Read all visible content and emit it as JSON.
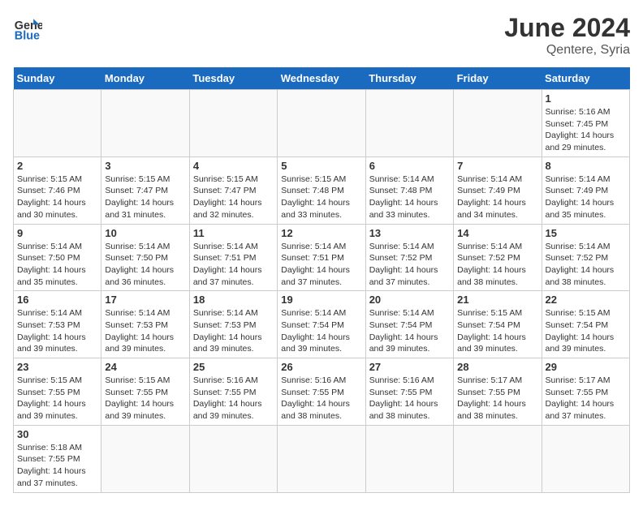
{
  "header": {
    "logo_general": "General",
    "logo_blue": "Blue",
    "month_title": "June 2024",
    "location": "Qentere, Syria"
  },
  "weekdays": [
    "Sunday",
    "Monday",
    "Tuesday",
    "Wednesday",
    "Thursday",
    "Friday",
    "Saturday"
  ],
  "weeks": [
    [
      {
        "day": "",
        "info": ""
      },
      {
        "day": "",
        "info": ""
      },
      {
        "day": "",
        "info": ""
      },
      {
        "day": "",
        "info": ""
      },
      {
        "day": "",
        "info": ""
      },
      {
        "day": "",
        "info": ""
      },
      {
        "day": "1",
        "info": "Sunrise: 5:16 AM\nSunset: 7:45 PM\nDaylight: 14 hours and 29 minutes."
      }
    ],
    [
      {
        "day": "2",
        "info": "Sunrise: 5:15 AM\nSunset: 7:46 PM\nDaylight: 14 hours and 30 minutes."
      },
      {
        "day": "3",
        "info": "Sunrise: 5:15 AM\nSunset: 7:47 PM\nDaylight: 14 hours and 31 minutes."
      },
      {
        "day": "4",
        "info": "Sunrise: 5:15 AM\nSunset: 7:47 PM\nDaylight: 14 hours and 32 minutes."
      },
      {
        "day": "5",
        "info": "Sunrise: 5:15 AM\nSunset: 7:48 PM\nDaylight: 14 hours and 33 minutes."
      },
      {
        "day": "6",
        "info": "Sunrise: 5:14 AM\nSunset: 7:48 PM\nDaylight: 14 hours and 33 minutes."
      },
      {
        "day": "7",
        "info": "Sunrise: 5:14 AM\nSunset: 7:49 PM\nDaylight: 14 hours and 34 minutes."
      },
      {
        "day": "8",
        "info": "Sunrise: 5:14 AM\nSunset: 7:49 PM\nDaylight: 14 hours and 35 minutes."
      }
    ],
    [
      {
        "day": "9",
        "info": "Sunrise: 5:14 AM\nSunset: 7:50 PM\nDaylight: 14 hours and 35 minutes."
      },
      {
        "day": "10",
        "info": "Sunrise: 5:14 AM\nSunset: 7:50 PM\nDaylight: 14 hours and 36 minutes."
      },
      {
        "day": "11",
        "info": "Sunrise: 5:14 AM\nSunset: 7:51 PM\nDaylight: 14 hours and 37 minutes."
      },
      {
        "day": "12",
        "info": "Sunrise: 5:14 AM\nSunset: 7:51 PM\nDaylight: 14 hours and 37 minutes."
      },
      {
        "day": "13",
        "info": "Sunrise: 5:14 AM\nSunset: 7:52 PM\nDaylight: 14 hours and 37 minutes."
      },
      {
        "day": "14",
        "info": "Sunrise: 5:14 AM\nSunset: 7:52 PM\nDaylight: 14 hours and 38 minutes."
      },
      {
        "day": "15",
        "info": "Sunrise: 5:14 AM\nSunset: 7:52 PM\nDaylight: 14 hours and 38 minutes."
      }
    ],
    [
      {
        "day": "16",
        "info": "Sunrise: 5:14 AM\nSunset: 7:53 PM\nDaylight: 14 hours and 39 minutes."
      },
      {
        "day": "17",
        "info": "Sunrise: 5:14 AM\nSunset: 7:53 PM\nDaylight: 14 hours and 39 minutes."
      },
      {
        "day": "18",
        "info": "Sunrise: 5:14 AM\nSunset: 7:53 PM\nDaylight: 14 hours and 39 minutes."
      },
      {
        "day": "19",
        "info": "Sunrise: 5:14 AM\nSunset: 7:54 PM\nDaylight: 14 hours and 39 minutes."
      },
      {
        "day": "20",
        "info": "Sunrise: 5:14 AM\nSunset: 7:54 PM\nDaylight: 14 hours and 39 minutes."
      },
      {
        "day": "21",
        "info": "Sunrise: 5:15 AM\nSunset: 7:54 PM\nDaylight: 14 hours and 39 minutes."
      },
      {
        "day": "22",
        "info": "Sunrise: 5:15 AM\nSunset: 7:54 PM\nDaylight: 14 hours and 39 minutes."
      }
    ],
    [
      {
        "day": "23",
        "info": "Sunrise: 5:15 AM\nSunset: 7:55 PM\nDaylight: 14 hours and 39 minutes."
      },
      {
        "day": "24",
        "info": "Sunrise: 5:15 AM\nSunset: 7:55 PM\nDaylight: 14 hours and 39 minutes."
      },
      {
        "day": "25",
        "info": "Sunrise: 5:16 AM\nSunset: 7:55 PM\nDaylight: 14 hours and 39 minutes."
      },
      {
        "day": "26",
        "info": "Sunrise: 5:16 AM\nSunset: 7:55 PM\nDaylight: 14 hours and 38 minutes."
      },
      {
        "day": "27",
        "info": "Sunrise: 5:16 AM\nSunset: 7:55 PM\nDaylight: 14 hours and 38 minutes."
      },
      {
        "day": "28",
        "info": "Sunrise: 5:17 AM\nSunset: 7:55 PM\nDaylight: 14 hours and 38 minutes."
      },
      {
        "day": "29",
        "info": "Sunrise: 5:17 AM\nSunset: 7:55 PM\nDaylight: 14 hours and 37 minutes."
      }
    ],
    [
      {
        "day": "30",
        "info": "Sunrise: 5:18 AM\nSunset: 7:55 PM\nDaylight: 14 hours and 37 minutes."
      },
      {
        "day": "",
        "info": ""
      },
      {
        "day": "",
        "info": ""
      },
      {
        "day": "",
        "info": ""
      },
      {
        "day": "",
        "info": ""
      },
      {
        "day": "",
        "info": ""
      },
      {
        "day": "",
        "info": ""
      }
    ]
  ]
}
